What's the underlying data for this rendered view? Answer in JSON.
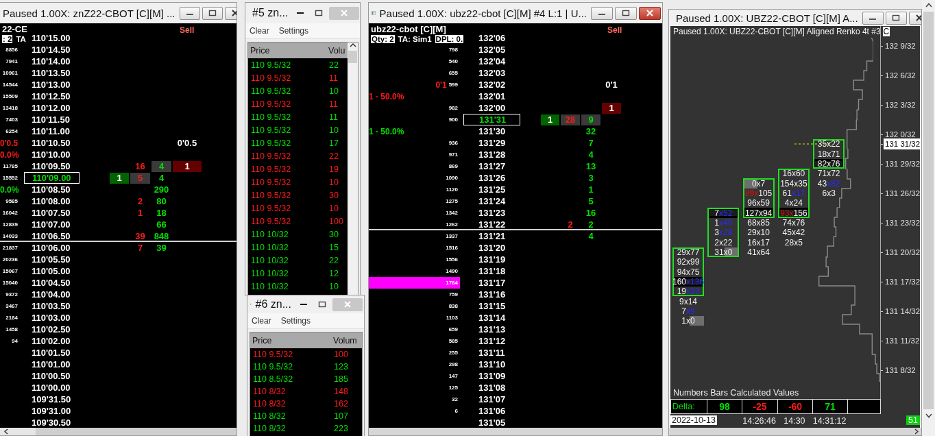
{
  "ladder_window_1": {
    "title": "Paused 1.00X: znZ22-CBOT [C][M]  ...",
    "header": {
      "symbol": "22-CE",
      "badges": [
        {
          "text": ": 2",
          "boxed": true
        },
        {
          "text": "TA",
          "boxed": false
        }
      ]
    },
    "sell_label": "Sell",
    "rows": [
      {
        "price": "110'15.00",
        "kind": "plain"
      },
      {
        "price": "110'14.50",
        "volume": "8856",
        "kind": "plain"
      },
      {
        "price": "110'14.00",
        "volume": "7941",
        "kind": "plain"
      },
      {
        "price": "110'13.50",
        "volume": "10961",
        "kind": "plain"
      },
      {
        "price": "110'13.00",
        "volume": "14544",
        "kind": "plain"
      },
      {
        "price": "110'12.50",
        "volume": "15509",
        "kind": "plain"
      },
      {
        "price": "110'12.00",
        "volume": "13418",
        "kind": "plain"
      },
      {
        "price": "110'11.50",
        "volume": "7403",
        "kind": "plain"
      },
      {
        "price": "110'11.00",
        "volume": "6254",
        "kind": "plain"
      },
      {
        "price": "110'10.50",
        "kind": "plain",
        "tag": {
          "text": "0'0.5",
          "color": "#ff1a1a"
        },
        "cells": [
          {
            "kind": "note",
            "text": "0'0.5",
            "shaded": false
          }
        ]
      },
      {
        "price": "110'10.00",
        "kind": "plain",
        "tag": {
          "text": "0.0%",
          "color": "#ff1a1a"
        }
      },
      {
        "price": "110'09.50",
        "volume": "11785",
        "kind": "plain",
        "cells": [
          {
            "kind": "sold",
            "text": "16",
            "shaded": false
          },
          {
            "kind": "bought",
            "text": "4",
            "shaded": true
          },
          {
            "kind": "ask_order",
            "text": "1",
            "shaded": false
          }
        ]
      },
      {
        "price": "110'09.00",
        "volume": "15552",
        "kind": "current",
        "cells": [
          {
            "kind": "bid_order",
            "text": "1",
            "shaded": false
          },
          {
            "kind": "sold",
            "text": "5",
            "shaded": true
          },
          {
            "kind": "bought",
            "text": "4",
            "shaded": false
          }
        ]
      },
      {
        "price": "110'08.50",
        "kind": "plain",
        "tag": {
          "text": "0.0%",
          "color": "#00e000"
        },
        "cells": [
          {
            "kind": "bought",
            "text": "290",
            "shaded": false
          }
        ]
      },
      {
        "price": "110'08.00",
        "volume": "9585",
        "kind": "plain",
        "cells": [
          {
            "kind": "sold",
            "text": "2",
            "shaded": false
          },
          {
            "kind": "bought",
            "text": "80",
            "shaded": false
          }
        ]
      },
      {
        "price": "110'07.50",
        "volume": "16042",
        "kind": "plain",
        "cells": [
          {
            "kind": "sold",
            "text": "1",
            "shaded": false
          },
          {
            "kind": "bought",
            "text": "18",
            "shaded": false
          }
        ]
      },
      {
        "price": "110'07.00",
        "volume": "12839",
        "kind": "plain",
        "cells": [
          {
            "kind": "bought",
            "text": "66",
            "shaded": false
          }
        ]
      },
      {
        "price": "110'06.50",
        "volume": "14033",
        "kind": "divider",
        "cells": [
          {
            "kind": "sold",
            "text": "39",
            "shaded": false
          },
          {
            "kind": "bought",
            "text": "848",
            "shaded": false
          }
        ]
      },
      {
        "price": "110'06.00",
        "volume": "21837",
        "kind": "plain",
        "cells": [
          {
            "kind": "sold",
            "text": "7",
            "shaded": false
          },
          {
            "kind": "bought",
            "text": "39",
            "shaded": false
          }
        ]
      },
      {
        "price": "110'05.50",
        "volume": "20236",
        "kind": "plain"
      },
      {
        "price": "110'05.00",
        "volume": "15067",
        "kind": "plain"
      },
      {
        "price": "110'04.50",
        "volume": "15040",
        "kind": "plain"
      },
      {
        "price": "110'04.00",
        "volume": "9372",
        "kind": "plain"
      },
      {
        "price": "110'03.50",
        "volume": "3467",
        "kind": "plain"
      },
      {
        "price": "110'03.00",
        "volume": "2184",
        "kind": "plain"
      },
      {
        "price": "110'02.50",
        "volume": "1458",
        "kind": "plain"
      },
      {
        "price": "110'02.00",
        "volume": "94",
        "kind": "plain"
      },
      {
        "price": "110'01.50",
        "kind": "plain"
      },
      {
        "price": "110'01.00",
        "kind": "plain"
      },
      {
        "price": "110'00.50",
        "kind": "plain"
      },
      {
        "price": "110'00.00",
        "kind": "plain"
      },
      {
        "price": "109'31.50",
        "kind": "plain"
      },
      {
        "price": "109'31.00",
        "kind": "plain"
      },
      {
        "price": "109'30.50",
        "kind": "plain"
      }
    ]
  },
  "tape_window_1": {
    "title": "#5 zn...",
    "toolbar": [
      "Clear",
      "Settings"
    ],
    "columns": [
      "Price",
      "Volu"
    ],
    "rows": [
      {
        "price": "110 9.5/32",
        "volume": "22",
        "color": "#00e000"
      },
      {
        "price": "110 9.5/32",
        "volume": "11",
        "color": "#ff1a1a"
      },
      {
        "price": "110 9.5/32",
        "volume": "10",
        "color": "#00e000"
      },
      {
        "price": "110 9.5/32",
        "volume": "11",
        "color": "#ff1a1a"
      },
      {
        "price": "110 9.5/32",
        "volume": "11",
        "color": "#00e000"
      },
      {
        "price": "110 9.5/32",
        "volume": "10",
        "color": "#00e000"
      },
      {
        "price": "110 9.5/32",
        "volume": "17",
        "color": "#00e000"
      },
      {
        "price": "110 9.5/32",
        "volume": "22",
        "color": "#ff1a1a"
      },
      {
        "price": "110 9.5/32",
        "volume": "19",
        "color": "#ff1a1a"
      },
      {
        "price": "110 9.5/32",
        "volume": "10",
        "color": "#ff1a1a"
      },
      {
        "price": "110 9.5/32",
        "volume": "30",
        "color": "#ff1a1a"
      },
      {
        "price": "110 9.5/32",
        "volume": "10",
        "color": "#ff1a1a"
      },
      {
        "price": "110 9.5/32",
        "volume": "100",
        "color": "#ff1a1a"
      },
      {
        "price": "110 10/32",
        "volume": "30",
        "color": "#00e000"
      },
      {
        "price": "110 10/32",
        "volume": "15",
        "color": "#00e000"
      },
      {
        "price": "110 10/32",
        "volume": "22",
        "color": "#00e000"
      },
      {
        "price": "110 10/32",
        "volume": "12",
        "color": "#00e000"
      },
      {
        "price": "110 10/32",
        "volume": "10",
        "color": "#00e000"
      }
    ]
  },
  "tape_window_2": {
    "title": "#6 zn...",
    "toolbar": [
      "Clear",
      "Settings"
    ],
    "columns": [
      "Price",
      "Volum"
    ],
    "rows": [
      {
        "price": "110 9.5/32",
        "volume": "100",
        "color": "#ff1a1a"
      },
      {
        "price": "110 9.5/32",
        "volume": "123",
        "color": "#00e000"
      },
      {
        "price": "110 8.5/32",
        "volume": "185",
        "color": "#00e000"
      },
      {
        "price": "110 8/32",
        "volume": "148",
        "color": "#ff1a1a"
      },
      {
        "price": "110 8/32",
        "volume": "162",
        "color": "#ff1a1a"
      },
      {
        "price": "110 8/32",
        "volume": "107",
        "color": "#00e000"
      },
      {
        "price": "110 8/32",
        "volume": "223",
        "color": "#00e000"
      }
    ]
  },
  "ladder_window_2": {
    "title": "Paused 1.00X: ubz22-cbot [C][M]  #4 L:1 | U...",
    "header": {
      "symbol": "ubz22-cbot [C][M]",
      "badges": [
        {
          "text": "Qty: 2",
          "boxed": true
        },
        {
          "text": "TA: Sim1",
          "boxed": false
        },
        {
          "text": "DPL: 0.",
          "boxed": true
        }
      ]
    },
    "sell_label": "Sell",
    "rows": [
      {
        "price": "132'06",
        "kind": "plain"
      },
      {
        "price": "132'05",
        "volume": "798",
        "kind": "plain"
      },
      {
        "price": "132'04",
        "volume": "540",
        "kind": "plain"
      },
      {
        "price": "132'03",
        "volume": "655",
        "kind": "plain"
      },
      {
        "price": "132'02",
        "volume": "599",
        "kind": "plain",
        "tag": {
          "text": "0'1",
          "color": "#ff1a1a"
        },
        "cells": [
          {
            "kind": "note",
            "text": "0'1",
            "shaded": false
          }
        ]
      },
      {
        "price": "132'01",
        "kind": "plain",
        "tag": {
          "text": "1 - 50.0%",
          "color": "#ff1a1a"
        }
      },
      {
        "price": "132'00",
        "volume": "982",
        "kind": "plain",
        "cells": [
          {
            "kind": "ask_order",
            "text": "1",
            "shaded": false
          }
        ]
      },
      {
        "price": "131'31",
        "volume": "900",
        "kind": "current",
        "cells": [
          {
            "kind": "bid_order",
            "text": "1",
            "shaded": false
          },
          {
            "kind": "sold",
            "text": "28",
            "shaded": true
          },
          {
            "kind": "bought",
            "text": "9",
            "shaded": true
          }
        ]
      },
      {
        "price": "131'30",
        "kind": "plain",
        "tag": {
          "text": "1 - 50.0%",
          "color": "#00e000"
        },
        "cells": [
          {
            "kind": "bought",
            "text": "32",
            "shaded": false
          }
        ]
      },
      {
        "price": "131'29",
        "volume": "936",
        "kind": "plain",
        "cells": [
          {
            "kind": "bought",
            "text": "7",
            "shaded": false
          }
        ]
      },
      {
        "price": "131'28",
        "volume": "971",
        "kind": "plain",
        "cells": [
          {
            "kind": "bought",
            "text": "4",
            "shaded": false
          }
        ]
      },
      {
        "price": "131'27",
        "volume": "869",
        "kind": "plain",
        "cells": [
          {
            "kind": "bought",
            "text": "13",
            "shaded": false
          }
        ]
      },
      {
        "price": "131'26",
        "volume": "1090",
        "kind": "plain",
        "cells": [
          {
            "kind": "bought",
            "text": "3",
            "shaded": false
          }
        ]
      },
      {
        "price": "131'25",
        "volume": "1120",
        "kind": "plain",
        "cells": [
          {
            "kind": "bought",
            "text": "1",
            "shaded": false
          }
        ]
      },
      {
        "price": "131'24",
        "volume": "1275",
        "kind": "plain",
        "cells": [
          {
            "kind": "bought",
            "text": "5",
            "shaded": false
          }
        ]
      },
      {
        "price": "131'23",
        "volume": "1342",
        "kind": "plain",
        "cells": [
          {
            "kind": "bought",
            "text": "16",
            "shaded": false
          }
        ]
      },
      {
        "price": "131'22",
        "volume": "1262",
        "kind": "divider",
        "cells": [
          {
            "kind": "sold",
            "text": "2",
            "shaded": false
          },
          {
            "kind": "bought",
            "text": "2",
            "shaded": false
          }
        ]
      },
      {
        "price": "131'21",
        "volume": "1337",
        "kind": "plain",
        "cells": [
          {
            "kind": "bought",
            "text": "4",
            "shaded": false
          }
        ]
      },
      {
        "price": "131'20",
        "volume": "1516",
        "kind": "plain"
      },
      {
        "price": "131'19",
        "volume": "1556",
        "kind": "plain"
      },
      {
        "price": "131'18",
        "volume": "1490",
        "kind": "plain"
      },
      {
        "price": "131'17",
        "volume": "1764",
        "kind": "max_volume"
      },
      {
        "price": "131'16",
        "volume": "759",
        "kind": "plain"
      },
      {
        "price": "131'15",
        "volume": "838",
        "kind": "plain"
      },
      {
        "price": "131'14",
        "volume": "1103",
        "kind": "plain"
      },
      {
        "price": "131'13",
        "volume": "659",
        "kind": "plain"
      },
      {
        "price": "131'12",
        "volume": "585",
        "kind": "plain"
      },
      {
        "price": "131'11",
        "volume": "255",
        "kind": "plain"
      },
      {
        "price": "131'10",
        "volume": "298",
        "kind": "plain"
      },
      {
        "price": "131'09",
        "volume": "147",
        "kind": "plain"
      },
      {
        "price": "131'08",
        "volume": "125",
        "kind": "plain"
      },
      {
        "price": "131'07",
        "volume": "32",
        "kind": "plain"
      },
      {
        "price": "131'06",
        "volume": "6",
        "kind": "plain"
      },
      {
        "price": "131'05",
        "kind": "plain"
      }
    ]
  },
  "chart_window": {
    "title": "Paused 1.00X: UBZ22-CBOT [C][M]  A...",
    "chart_title": "Paused 1.00X: UBZ22-CBOT [C][M]  Aligned Renko 4t  #3",
    "title_badge": "C",
    "price_axis": [
      {
        "label": "132 9/32",
        "current": false
      },
      {
        "label": "132 6/32",
        "current": false
      },
      {
        "label": "132 3/32",
        "current": false
      },
      {
        "label": "132 0/32",
        "current": false
      },
      {
        "label": "131 31/32",
        "current": true
      },
      {
        "label": "131 29/32",
        "current": false
      },
      {
        "label": "131 26/32",
        "current": false
      },
      {
        "label": "131 23/32",
        "current": false
      },
      {
        "label": "131 20/32",
        "current": false
      },
      {
        "label": "131 17/32",
        "current": false
      },
      {
        "label": "131 14/32",
        "current": false
      },
      {
        "label": "131 11/32",
        "current": false
      },
      {
        "label": "131 8/32",
        "current": false
      }
    ],
    "bars": [
      {
        "cells": [
          null,
          null,
          null,
          null,
          null,
          null,
          null,
          null,
          null,
          null,
          null,
          {
            "bid": "29x",
            "ask": "77",
            "kind": "plain",
            "poc": false,
            "in_body": true
          },
          {
            "bid": "92x",
            "ask": "99",
            "kind": "plain",
            "poc": false,
            "in_body": true
          },
          {
            "bid": "94x",
            "ask": "75",
            "kind": "plain",
            "poc": false,
            "in_body": true
          },
          {
            "bid": "160",
            "ask": "x136",
            "kind": "ask_imbalance",
            "poc": true,
            "in_body": true
          },
          {
            "bid": "19",
            "ask": "x33",
            "kind": "ask_imbalance",
            "poc": false,
            "in_body": true
          },
          {
            "bid": "9x",
            "ask": "14",
            "kind": "plain",
            "poc": false,
            "in_body": false
          },
          {
            "bid": "7",
            "ask": "x9",
            "kind": "ask_imbalance",
            "poc": false,
            "in_body": false
          },
          {
            "bid": "1x",
            "ask": "0",
            "kind": "ask_bar",
            "poc": false,
            "in_body": false
          }
        ]
      },
      {
        "cells": [
          null,
          null,
          null,
          null,
          null,
          null,
          null,
          {
            "bid": "7",
            "ask": "x52",
            "kind": "ask_imbalance",
            "poc": true,
            "in_body": true
          },
          {
            "bid": "1",
            "ask": "x40",
            "kind": "ask_imbalance",
            "poc": false,
            "in_body": true
          },
          {
            "bid": "3",
            "ask": "x28",
            "kind": "ask_imbalance",
            "poc": false,
            "in_body": true
          },
          {
            "bid": "2x",
            "ask": "22",
            "kind": "plain",
            "poc": false,
            "in_body": true
          },
          {
            "bid": "31x",
            "ask": "0",
            "kind": "ask_bar",
            "poc": false,
            "in_body": true
          }
        ]
      },
      {
        "time": "14:26:46",
        "cells": [
          null,
          null,
          null,
          null,
          {
            "bid": "0x",
            "ask": "7",
            "kind": "bid_bar",
            "poc": false,
            "in_body": true
          },
          {
            "bid": "89x",
            "ask": "105",
            "kind": "bid_imbalance",
            "poc": false,
            "in_body": true
          },
          {
            "bid": "96x",
            "ask": "59",
            "kind": "plain",
            "poc": false,
            "in_body": true
          },
          {
            "bid": "127x",
            "ask": "94",
            "kind": "plain",
            "poc": true,
            "in_body": true
          },
          {
            "bid": "68x",
            "ask": "85",
            "kind": "plain",
            "poc": false,
            "in_body": false
          },
          {
            "bid": "29x",
            "ask": "10",
            "kind": "plain",
            "poc": false,
            "in_body": false
          },
          {
            "bid": "16x",
            "ask": "17",
            "kind": "plain",
            "poc": false,
            "in_body": false
          },
          {
            "bid": "41x",
            "ask": "64",
            "kind": "plain",
            "poc": false,
            "in_body": false
          }
        ]
      },
      {
        "time": "14:30",
        "cells": [
          null,
          null,
          null,
          {
            "bid": "16x",
            "ask": "60",
            "kind": "plain",
            "poc": false,
            "in_body": true
          },
          {
            "bid": "154x",
            "ask": "35",
            "kind": "plain",
            "poc": false,
            "in_body": true
          },
          {
            "bid": "61",
            "ask": "x17",
            "kind": "ask_imbalance",
            "poc": false,
            "in_body": true
          },
          {
            "bid": "4x",
            "ask": "24",
            "kind": "plain",
            "poc": false,
            "in_body": true
          },
          {
            "bid": "93x",
            "ask": "156",
            "kind": "bid_imbalance",
            "poc": true,
            "in_body": true
          },
          {
            "bid": "74x",
            "ask": "76",
            "kind": "plain",
            "poc": false,
            "in_body": false
          },
          {
            "bid": "45x",
            "ask": "42",
            "kind": "plain",
            "poc": false,
            "in_body": false
          },
          {
            "bid": "28x",
            "ask": "5",
            "kind": "plain",
            "poc": false,
            "in_body": false
          }
        ]
      },
      {
        "time": "14:31:12",
        "cells": [
          {
            "bid": "35x",
            "ask": "22",
            "kind": "plain",
            "poc": false,
            "in_body": true
          },
          {
            "bid": "18x",
            "ask": "71",
            "kind": "plain",
            "poc": false,
            "in_body": true
          },
          {
            "bid": "82x",
            "ask": "76",
            "kind": "plain",
            "poc": true,
            "in_body": true
          },
          {
            "bid": "71x",
            "ask": "72",
            "kind": "plain",
            "poc": false,
            "in_body": false
          },
          {
            "bid": "43",
            "ask": "x82",
            "kind": "ask_imbalance",
            "poc": false,
            "in_body": false
          },
          {
            "bid": "6x",
            "ask": "3",
            "kind": "plain",
            "poc": false,
            "in_body": false
          }
        ]
      }
    ],
    "footer_label": "Numbers Bars Calculated Values",
    "delta": {
      "label": "Delta:",
      "values": [
        {
          "text": "98",
          "color": "#00e000"
        },
        {
          "text": "-25",
          "color": "#ff1a1a"
        },
        {
          "text": "-60",
          "color": "#ff1a1a"
        },
        {
          "text": "71",
          "color": "#00e000"
        }
      ]
    },
    "date": "2022-10-13",
    "status_badge": "51"
  }
}
